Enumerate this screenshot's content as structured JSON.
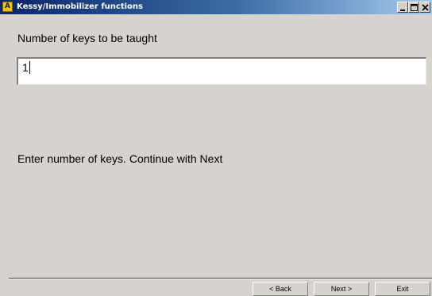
{
  "window": {
    "title": "Kessy/Immobilizer functions",
    "icon_letter": "A",
    "colors": {
      "titlebar_start": "#0a246a",
      "titlebar_end": "#a6caf0",
      "background": "#d6d3ce"
    }
  },
  "title_buttons": {
    "minimize_icon": "minimize-icon",
    "maximize_icon": "maximize-icon",
    "close_icon": "close-icon"
  },
  "form": {
    "prompt_label": "Number of keys to be taught",
    "key_count_value": "1",
    "instruction": "Enter number of keys. Continue with Next"
  },
  "footer": {
    "back_label": "< Back",
    "next_label": "Next >",
    "exit_label": "Exit"
  }
}
